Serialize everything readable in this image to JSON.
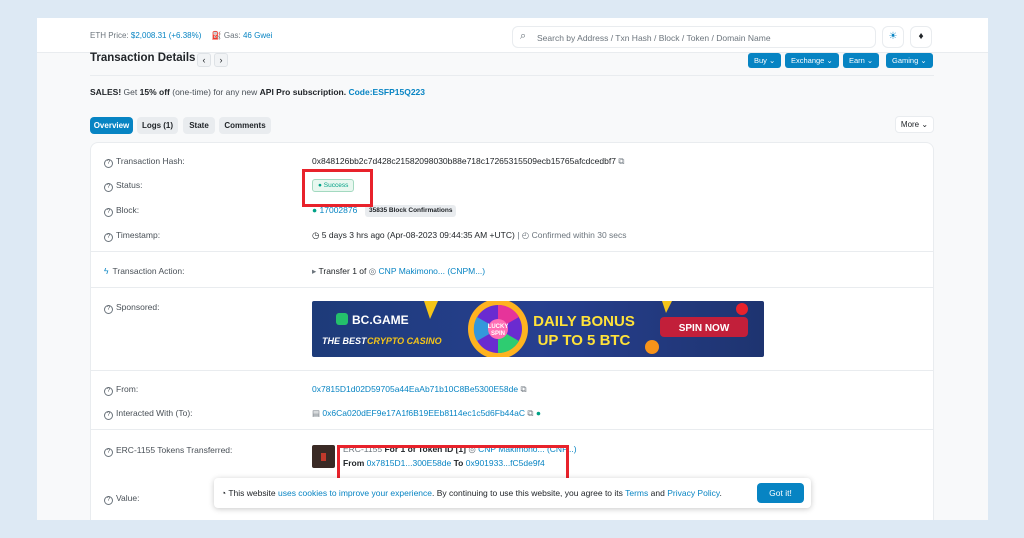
{
  "header": {
    "eth_price_label": "ETH Price:",
    "eth_price_value": "$2,008.31 (+6.38%)",
    "gas_label": "Gas:",
    "gas_value": "46 Gwei",
    "search_placeholder": "Search by Address / Txn Hash / Block / Token / Domain Name"
  },
  "page": {
    "title": "Transaction Details",
    "menus": [
      "Buy",
      "Exchange",
      "Earn",
      "Gaming"
    ]
  },
  "promo": {
    "prefix": "SALES!",
    "text1": "Get",
    "discount": "15% off",
    "text2": "(one-time) for any new",
    "product": "API Pro subscription.",
    "code": "Code:ESFP15Q223"
  },
  "tabs": [
    "Overview",
    "Logs (1)",
    "State",
    "Comments"
  ],
  "more_label": "More",
  "details": {
    "hash_label": "Transaction Hash:",
    "hash_value": "0x848126bb2c7d428c21582098030b88e718c17265315509ecb15765afcdcedbf7",
    "status_label": "Status:",
    "status_value": "Success",
    "block_label": "Block:",
    "block_value": "17002876",
    "block_confirmations": "35835 Block Confirmations",
    "timestamp_label": "Timestamp:",
    "timestamp_value": "5 days 3 hrs ago (Apr-08-2023 09:44:35 AM +UTC)",
    "timestamp_confirmed": "Confirmed within 30 secs",
    "action_label": "Transaction Action:",
    "action_prefix": "Transfer 1 of",
    "action_token": "CNP Makimono... (CNPM...)",
    "sponsored_label": "Sponsored:",
    "from_label": "From:",
    "from_value": "0x7815D1d02D59705a44EaAb71b10C8Be5300E58de",
    "to_label": "Interacted With (To):",
    "to_value": "0x6Ca020dEF9e17A1f6B19EEb8114ec1c5d6Fb44aC",
    "erc_label": "ERC-1155 Tokens Transferred:",
    "erc_line1_prefix": "ERC-1155",
    "erc_line1_mid": "For 1 of Token ID [1]",
    "erc_line1_token": "CNP Makimono... (CNP...)",
    "erc_from_label": "From",
    "erc_from_value": "0x7815D1...300E58de",
    "erc_to_label": "To",
    "erc_to_value": "0x901933...fC5de9f4",
    "value_label": "Value:"
  },
  "ad": {
    "brand": "BC.GAME",
    "tagline1": "THE BEST",
    "tagline2": "CRYPTO CASINO",
    "wheel_text1": "LUCKY",
    "wheel_text2": "SPIN",
    "headline1": "DAILY BONUS",
    "headline2": "UP TO 5 BTC",
    "cta": "SPIN NOW"
  },
  "cookie": {
    "prefix": "This website",
    "link1": "uses cookies to improve your experience",
    "mid": ". By continuing to use this website, you agree to its",
    "link2": "Terms",
    "and": "and",
    "link3": "Privacy Policy",
    "end": ".",
    "button": "Got it!"
  },
  "colors": {
    "brand_blue": "#0784c3",
    "success_green": "#00a186",
    "highlight_red": "#e8222b"
  }
}
